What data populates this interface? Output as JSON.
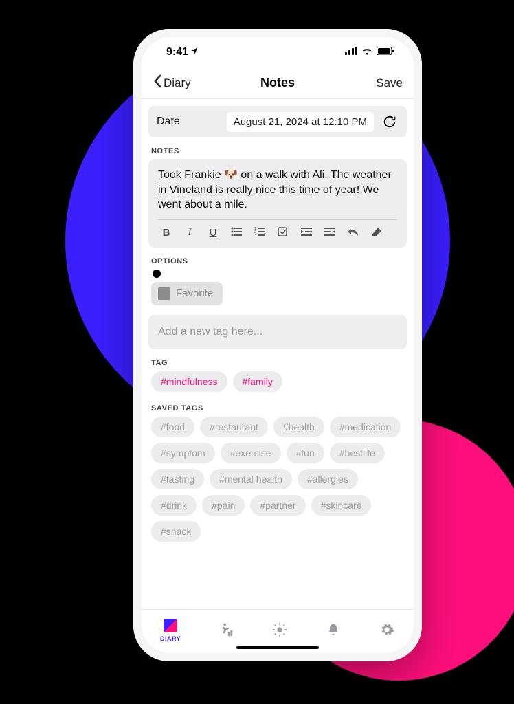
{
  "status": {
    "time": "9:41"
  },
  "nav": {
    "back": "Diary",
    "title": "Notes",
    "save": "Save"
  },
  "date": {
    "label": "Date",
    "value": "August 21, 2024 at 12:10 PM"
  },
  "sections": {
    "notes_label": "NOTES",
    "options_label": "OPTIONS",
    "tag_label": "TAG",
    "saved_tags_label": "SAVED TAGS"
  },
  "notes": {
    "text": "Took Frankie 🐶 on a walk with Ali. The weather in Vineland is really nice this time of year! We went about a mile."
  },
  "options": {
    "favorite": "Favorite"
  },
  "tag_input": {
    "placeholder": "Add a new tag here..."
  },
  "tags": {
    "active": [
      "#mindfulness",
      "#family"
    ],
    "saved": [
      "#food",
      "#restaurant",
      "#health",
      "#medication",
      "#symptom",
      "#exercise",
      "#fun",
      "#bestlife",
      "#fasting",
      "#mental health",
      "#allergies",
      "#drink",
      "#pain",
      "#partner",
      "#skincare",
      "#snack"
    ]
  },
  "tabs": {
    "diary": "DIARY"
  }
}
